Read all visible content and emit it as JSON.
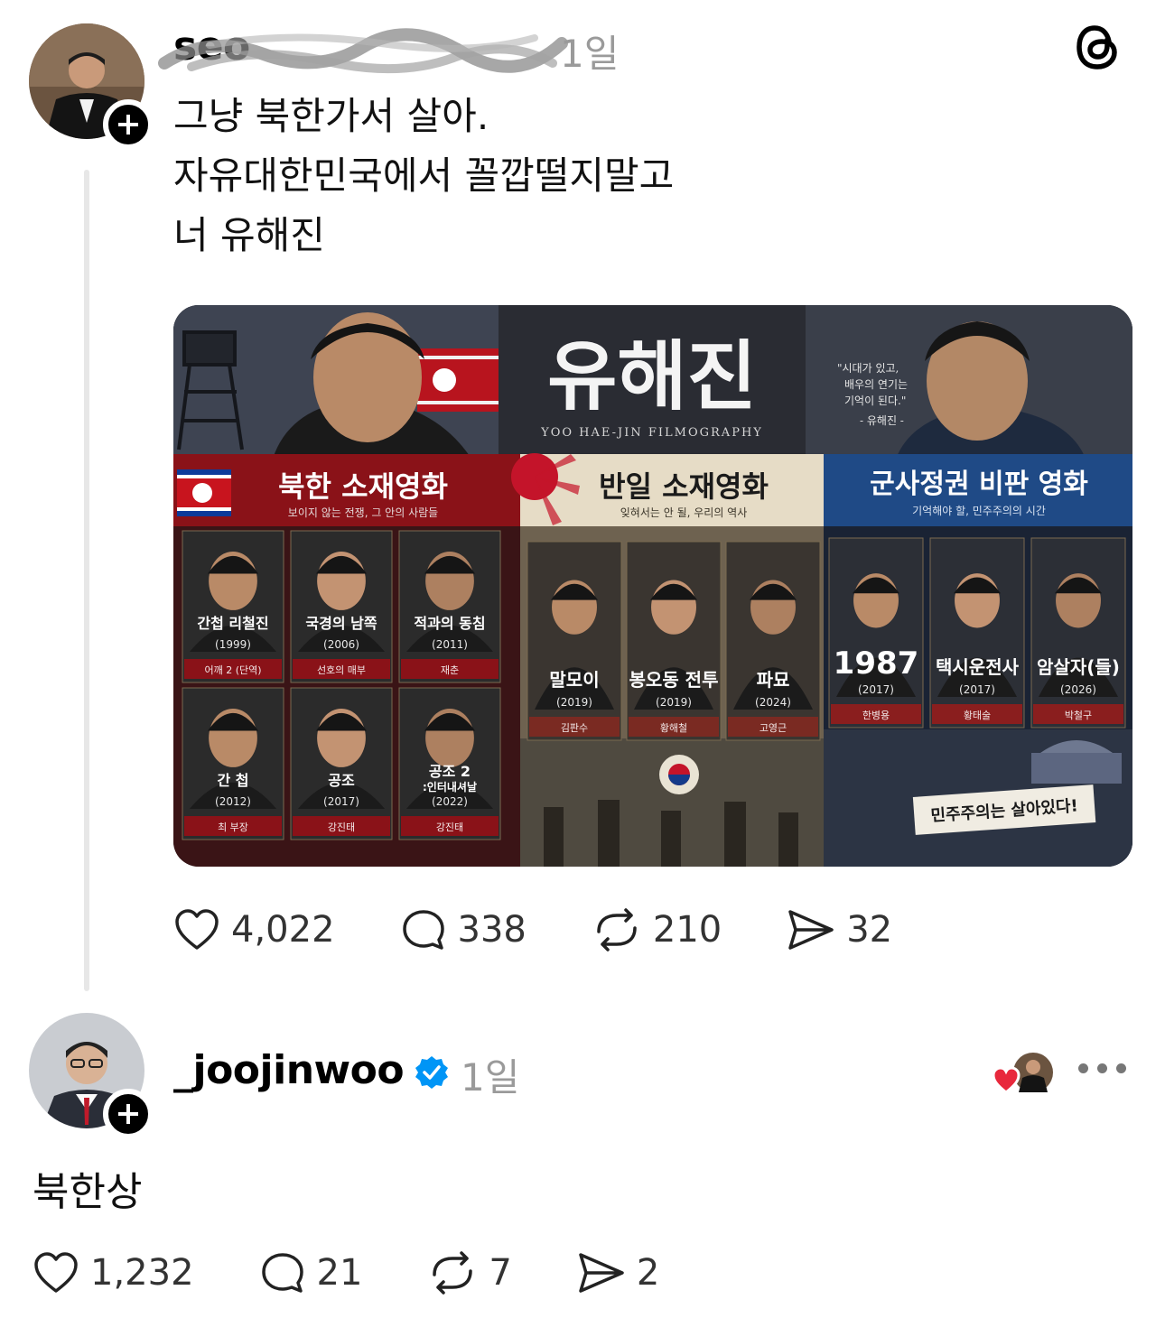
{
  "post": {
    "username": "seo",
    "time": "1일",
    "lines": [
      "그냥 북한가서 살아.",
      "자유대한민국에서 꼴깝떨지말고",
      "너 유해진"
    ],
    "stats": {
      "likes": "4,022",
      "comments": "338",
      "reposts": "210",
      "shares": "32"
    }
  },
  "poster": {
    "title": "유해진",
    "subtitle": "YOO HAE-JIN FILMOGRAPHY",
    "quote": [
      "\"시대가 있고,",
      "배우의 연기는",
      "기억이 된다.\"",
      "- 유해진 -"
    ],
    "sections": [
      {
        "title": "북한 소재영화",
        "subtitle": "보이지 않는 전쟁, 그 안의 사람들",
        "films": [
          {
            "title": "간첩 리철진",
            "year": "(1999)",
            "role": "어깨 2 (단역)"
          },
          {
            "title": "국경의 남쪽",
            "year": "(2006)",
            "role": "선호의 매부"
          },
          {
            "title": "적과의 동침",
            "year": "(2011)",
            "role": "재춘"
          },
          {
            "title": "간 첩",
            "year": "(2012)",
            "role": "최 부장"
          },
          {
            "title": "공조",
            "year": "(2017)",
            "role": "강진태"
          },
          {
            "title": "공조 2",
            "title2": ":인터내셔날",
            "year": "(2022)",
            "role": "강진태"
          }
        ]
      },
      {
        "title": "반일 소재영화",
        "subtitle": "잊혀서는 안 될, 우리의 역사",
        "films": [
          {
            "title": "말모이",
            "year": "(2019)",
            "role": "김판수"
          },
          {
            "title": "봉오동 전투",
            "year": "(2019)",
            "role": "황해철"
          },
          {
            "title": "파묘",
            "year": "(2024)",
            "role": "고영근"
          }
        ]
      },
      {
        "title": "군사정권 비판 영화",
        "subtitle": "기억해야 할, 민주주의의 시간",
        "films": [
          {
            "title": "1987",
            "year": "(2017)",
            "role": "한병용"
          },
          {
            "title": "택시운전사",
            "year": "(2017)",
            "role": "황태술"
          },
          {
            "title": "암살자(들)",
            "year": "(2026)",
            "role": "박철구"
          }
        ],
        "banner": "민주주의는 살아있다!"
      }
    ]
  },
  "reply": {
    "username": "_joojinwoo",
    "time": "1일",
    "text": "북한상",
    "stats": {
      "likes": "1,232",
      "comments": "21",
      "reposts": "7",
      "shares": "2"
    }
  },
  "colors": {
    "north": "#b8141e",
    "japan": "#c9b48a",
    "military": "#1f4a86",
    "verified": "#0095f6",
    "heart": "#e8283c"
  },
  "icons": [
    "threads-logo-icon",
    "plus-icon",
    "heart-icon",
    "comment-icon",
    "repost-icon",
    "share-icon",
    "verified-badge-icon",
    "more-icon"
  ]
}
